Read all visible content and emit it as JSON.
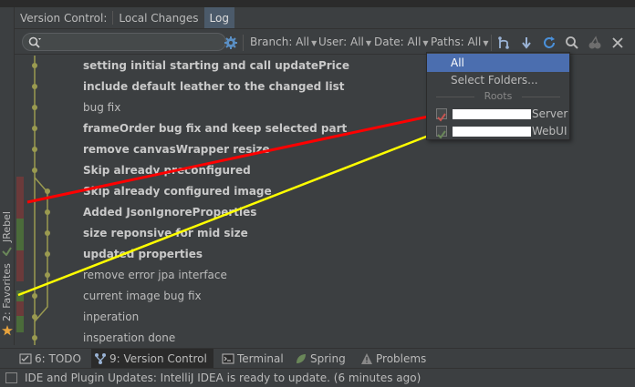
{
  "tool_window": {
    "title": "Version Control:",
    "tabs": [
      {
        "label": "Local Changes",
        "active": false
      },
      {
        "label": "Log",
        "active": true
      }
    ]
  },
  "toolbar": {
    "search_placeholder": "",
    "filters": {
      "branch": "Branch: All",
      "user": "User: All",
      "date": "Date: All",
      "paths": "Paths: All"
    },
    "icons": [
      "gear-icon",
      "branch-icon",
      "arrow-down-icon",
      "refresh-icon",
      "search-icon",
      "cherry-pick-icon",
      "expand-icon"
    ]
  },
  "commits": [
    {
      "message": "setting initial starting and call updatePrice",
      "bold": true
    },
    {
      "message": "include default leather to the changed list",
      "bold": true
    },
    {
      "message": "bug fix",
      "bold": false
    },
    {
      "message": "frameOrder bug fix and keep selected part",
      "bold": true
    },
    {
      "message": "remove canvasWrapper resize",
      "bold": true
    },
    {
      "message": "Skip already preconfigured",
      "bold": true
    },
    {
      "message": "Skip already configured image",
      "bold": true
    },
    {
      "message": "Added JsonIgnoreProperties",
      "bold": true
    },
    {
      "message": "size reponsive for mid size",
      "bold": true
    },
    {
      "message": "updated properties",
      "bold": true
    },
    {
      "message": "remove error jpa interface",
      "bold": false
    },
    {
      "message": "current image bug fix",
      "bold": false
    },
    {
      "message": "inperation",
      "bold": false
    },
    {
      "message": "insperation done",
      "bold": false
    }
  ],
  "paths_popup": {
    "items": [
      "All",
      "Select Folders..."
    ],
    "selected": "All",
    "roots_header": "Roots",
    "roots": [
      {
        "suffix": "Server",
        "color": "#c75450"
      },
      {
        "suffix": "WebUI",
        "color": "#6a8759"
      }
    ]
  },
  "side_labels": {
    "jrebel": "JRebel",
    "favorites": "2: Favorites"
  },
  "bottom_tabs": [
    {
      "label": "6: TODO",
      "icon": "todo-icon",
      "active": false
    },
    {
      "label": "9: Version Control",
      "icon": "version-control-icon",
      "active": true
    },
    {
      "label": "Terminal",
      "icon": "terminal-icon",
      "active": false
    },
    {
      "label": "Spring",
      "icon": "spring-icon",
      "active": false
    },
    {
      "label": "Problems",
      "icon": "warning-icon",
      "active": false
    }
  ],
  "status_bar": {
    "message": "IDE and Plugin Updates: IntelliJ IDEA is ready to update. (6 minutes ago)"
  },
  "colors": {
    "annotation_red": "#ff0000",
    "annotation_yellow": "#ffff00",
    "selection": "#4b6eaf",
    "graph_olive": "#9a9a50"
  }
}
